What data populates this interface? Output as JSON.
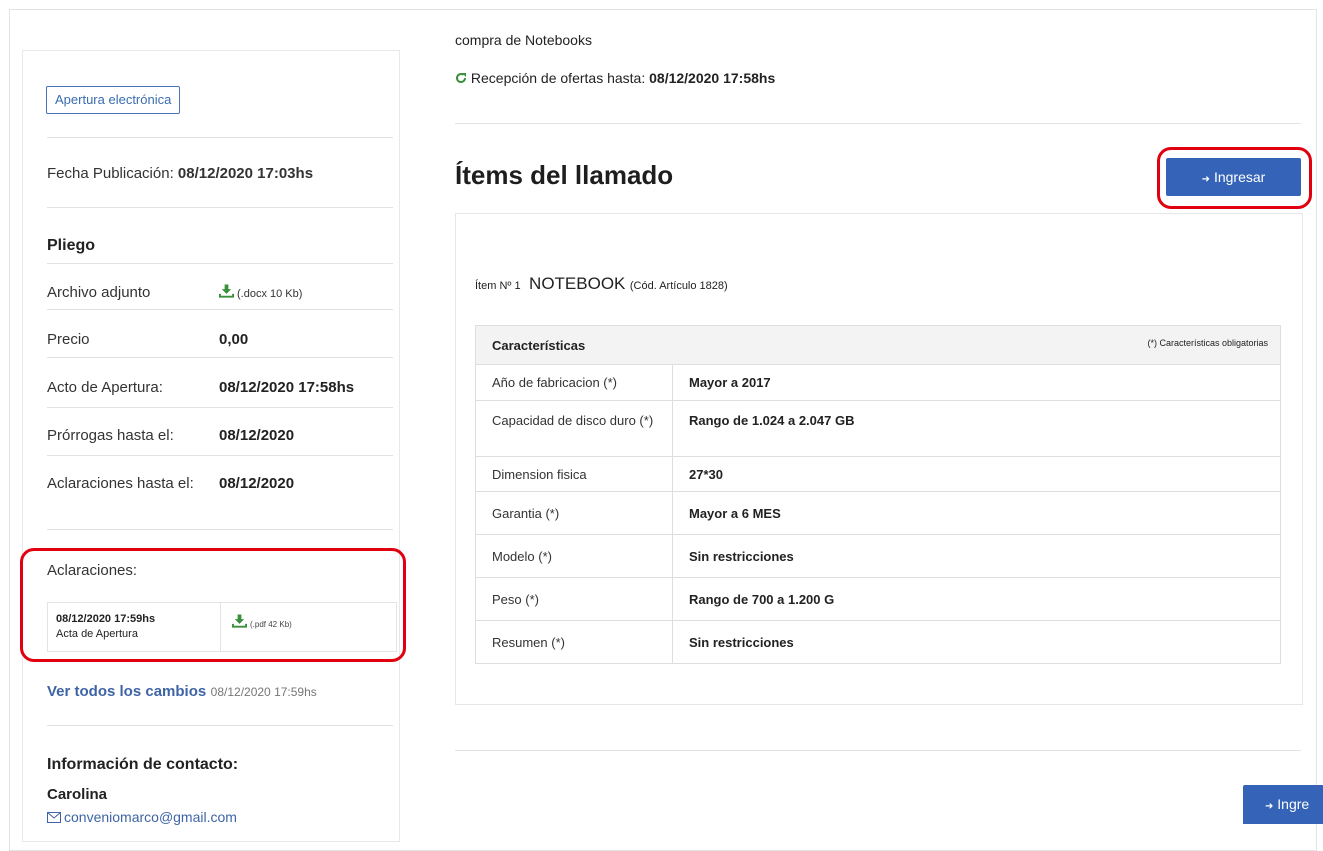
{
  "sidebar": {
    "apertura_button": "Apertura electrónica",
    "fecha_publicacion_label": "Fecha Publicación:",
    "fecha_publicacion_value": "08/12/2020 17:03hs",
    "pliego_title": "Pliego",
    "rows": [
      {
        "label": "Archivo adjunto",
        "value": "(.docx 10 Kb)"
      },
      {
        "label": "Precio",
        "value": "0,00"
      },
      {
        "label": "Acto de Apertura:",
        "value": "08/12/2020 17:58hs"
      },
      {
        "label": "Prórrogas hasta el:",
        "value": "08/12/2020"
      },
      {
        "label": "Aclaraciones hasta el:",
        "value": "08/12/2020"
      }
    ],
    "aclaraciones_title": "Aclaraciones:",
    "aclaracion": {
      "date": "08/12/2020 17:59hs",
      "name": "Acta de Apertura",
      "file": "(.pdf 42 Kb)"
    },
    "ver_cambios_link": "Ver todos los cambios",
    "ver_cambios_date": "08/12/2020 17:59hs",
    "contacto_title": "Información de contacto:",
    "contacto_name": "Carolina",
    "contacto_email": "conveniomarco@gmail.com"
  },
  "main": {
    "subtitle": "compra de Notebooks",
    "recepcion_label": "Recepción de ofertas hasta:",
    "recepcion_value": "08/12/2020 17:58hs",
    "heading": "Ítems del llamado",
    "ingresar_label": "Ingresar",
    "ingresar_bottom_label": "Ingre",
    "item": {
      "prefix": "Ítem Nº 1",
      "name": "NOTEBOOK",
      "code": "(Cód. Artículo 1828)"
    },
    "table": {
      "header": "Características",
      "header_note": "(*) Características obligatorias",
      "rows": [
        {
          "k": "Año de fabricacion (*)",
          "v": "Mayor a 2017"
        },
        {
          "k": "Capacidad de disco duro (*)",
          "v": "Rango de 1.024 a 2.047 GB"
        },
        {
          "k": "Dimension fisica",
          "v": "27*30"
        },
        {
          "k": "Garantia (*)",
          "v": "Mayor a 6 MES"
        },
        {
          "k": "Modelo (*)",
          "v": "Sin restricciones"
        },
        {
          "k": "Peso (*)",
          "v": "Rango de 700 a 1.200 G"
        },
        {
          "k": "Resumen (*)",
          "v": "Sin restricciones"
        }
      ]
    }
  },
  "colors": {
    "primary": "#3563b7",
    "highlight": "#e1000f",
    "link": "#3e64a6",
    "download": "#3a8f3a"
  }
}
